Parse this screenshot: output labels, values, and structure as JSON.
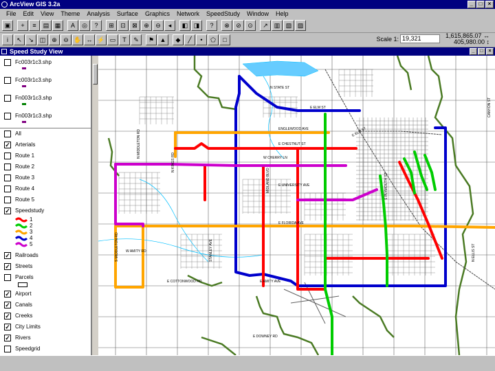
{
  "app": {
    "title": "ArcView GIS 3.2a"
  },
  "window_buttons": [
    "_",
    "□",
    "×"
  ],
  "menu": [
    "File",
    "Edit",
    "View",
    "Theme",
    "Analysis",
    "Surface",
    "Graphics",
    "Network",
    "SpeedStudy",
    "Window",
    "Help"
  ],
  "toolbar": {
    "scale_label": "Scale 1:",
    "scale_value": "19,321",
    "coord_x": "1,615,865.07 ↔",
    "coord_y": "405,980.00 ↕"
  },
  "view": {
    "title": "Speed Study View"
  },
  "toc": {
    "themes": [
      {
        "name": "Fc003r1c3.shp",
        "checked": false,
        "symbol_color": "#800080"
      },
      {
        "name": "Fc003r1c3.shp",
        "checked": false,
        "symbol_color": "#800080"
      },
      {
        "name": "Fn003r1c3.shp",
        "checked": false,
        "symbol_color": "#008000"
      },
      {
        "name": "Fn003r1c3.shp",
        "checked": false,
        "symbol_color": "#800080"
      },
      {
        "name": "All",
        "checked": false
      },
      {
        "name": "Arterials",
        "checked": true
      },
      {
        "name": "Route 1",
        "checked": false
      },
      {
        "name": "Route 2",
        "checked": false
      },
      {
        "name": "Route 3",
        "checked": false
      },
      {
        "name": "Route 4",
        "checked": false
      },
      {
        "name": "Route 5",
        "checked": false
      },
      {
        "name": "Speedstudy",
        "checked": true
      }
    ],
    "legend": [
      {
        "label": "1",
        "color": "#ff0000"
      },
      {
        "label": "2",
        "color": "#00cc00"
      },
      {
        "label": "3",
        "color": "#ffa500"
      },
      {
        "label": "4",
        "color": "#0000cc"
      },
      {
        "label": "5",
        "color": "#cc00cc"
      }
    ],
    "themes_lower": [
      {
        "name": "Railroads",
        "checked": true
      },
      {
        "name": "Streets",
        "checked": true
      },
      {
        "name": "Parcels",
        "checked": false
      },
      {
        "name": "Airport",
        "checked": true
      },
      {
        "name": "Canals",
        "checked": true
      },
      {
        "name": "Creeks",
        "checked": true
      },
      {
        "name": "City Limits",
        "checked": true
      },
      {
        "name": "Rivers",
        "checked": true
      },
      {
        "name": "Speedgrid",
        "checked": false
      }
    ]
  },
  "map_labels": [
    "N STATE ST",
    "E ELM ST",
    "ENGLEWOOD AVE",
    "E CHESTNUT ST",
    "W CHERRY LN",
    "E ELM ST",
    "E UNIVERSITY AVE",
    "E FLORIDA AVE",
    "E COTTONWOOD RD",
    "E AMITY AVE",
    "W AMITY RD",
    "E DOWNEY RD",
    "N MIDDLETON RD",
    "S MIDDLETON RD",
    "N KINGS RD",
    "S PLYMOUTH ST",
    "STANLEY AVE",
    "MIDLAND BLVD",
    "N ELLIS ST",
    "CANYON ST"
  ],
  "colors": {
    "title_bar": "#000080",
    "route_red": "#ff0000",
    "route_green": "#00cc00",
    "route_orange": "#ffa500",
    "route_blue": "#0000cc",
    "route_purple": "#cc00cc",
    "city_limits": "#4a7a23",
    "water": "#00bfff"
  },
  "icons": {
    "app": "arcview-globe-icon",
    "view": "view-window-icon"
  }
}
